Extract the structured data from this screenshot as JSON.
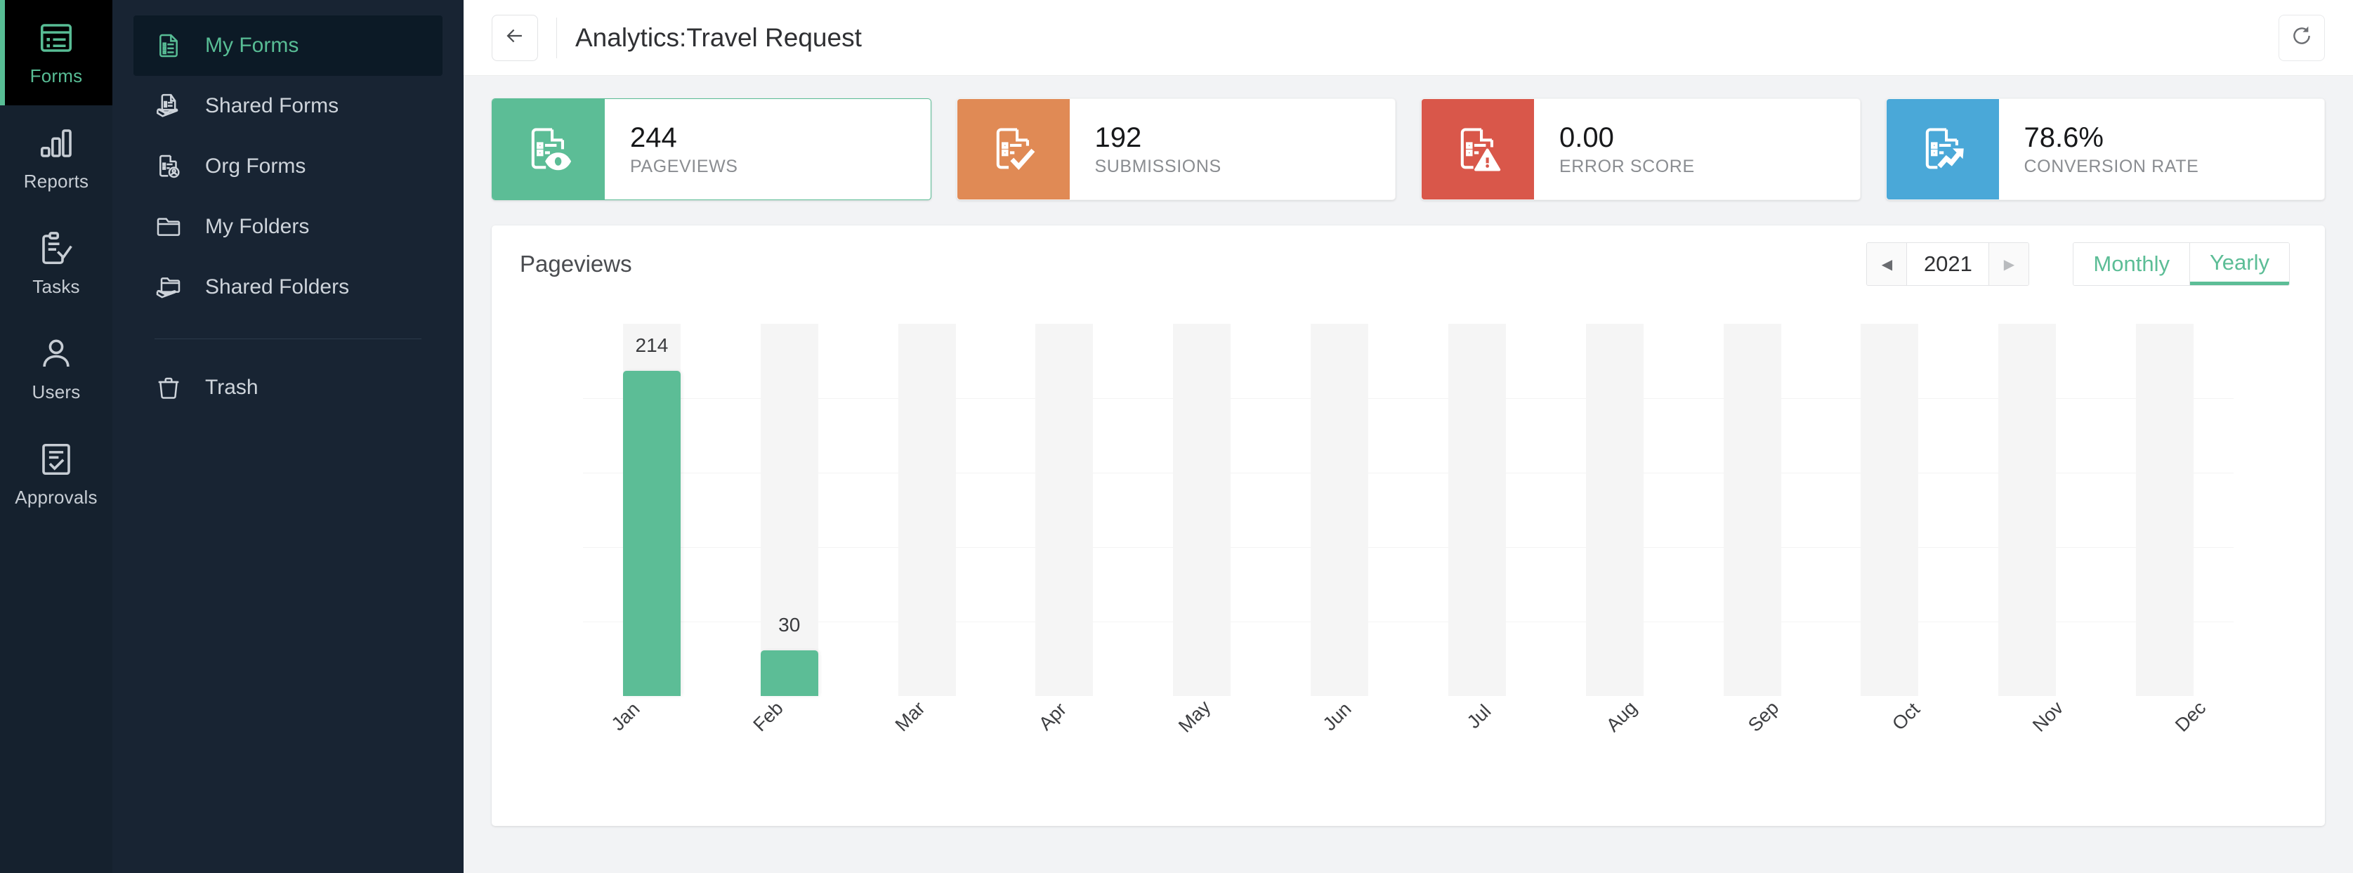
{
  "rail": {
    "items": [
      {
        "label": "Forms",
        "icon": "forms-icon",
        "active": true
      },
      {
        "label": "Reports",
        "icon": "reports-icon",
        "active": false
      },
      {
        "label": "Tasks",
        "icon": "tasks-icon",
        "active": false
      },
      {
        "label": "Users",
        "icon": "users-icon",
        "active": false
      },
      {
        "label": "Approvals",
        "icon": "approvals-icon",
        "active": false
      }
    ]
  },
  "subnav": {
    "items": [
      {
        "label": "My Forms",
        "icon": "document-list-icon",
        "active": true
      },
      {
        "label": "Shared Forms",
        "icon": "document-shared-icon",
        "active": false
      },
      {
        "label": "Org Forms",
        "icon": "document-user-icon",
        "active": false
      },
      {
        "label": "My Folders",
        "icon": "folder-icon",
        "active": false
      },
      {
        "label": "Shared Folders",
        "icon": "folder-shared-icon",
        "active": false
      }
    ],
    "trash": {
      "label": "Trash",
      "icon": "trash-icon"
    }
  },
  "topbar": {
    "back_icon": "arrow-left-icon",
    "title": "Analytics:Travel Request",
    "refresh_icon": "refresh-icon"
  },
  "cards": [
    {
      "value": "244",
      "label": "PAGEVIEWS",
      "icon": "document-eye-icon",
      "color": "#5cbd96",
      "accent": "accent-green"
    },
    {
      "value": "192",
      "label": "SUBMISSIONS",
      "icon": "document-check-icon",
      "color": "#e08a55",
      "accent": "accent-orange"
    },
    {
      "value": "0.00",
      "label": "ERROR SCORE",
      "icon": "document-alert-icon",
      "color": "#d9574a",
      "accent": "accent-red"
    },
    {
      "value": "78.6%",
      "label": "CONVERSION RATE",
      "icon": "document-trend-icon",
      "color": "#4aa8d8",
      "accent": "accent-blue"
    }
  ],
  "panel": {
    "title": "Pageviews",
    "year": "2021",
    "prev_icon": "caret-left-icon",
    "next_icon": "caret-right-icon",
    "range_options": [
      {
        "label": "Monthly",
        "active": false
      },
      {
        "label": "Yearly",
        "active": true
      }
    ]
  },
  "chart_data": {
    "type": "bar",
    "title": "Pageviews",
    "xlabel": "",
    "ylabel": "",
    "categories": [
      "Jan",
      "Feb",
      "Mar",
      "Apr",
      "May",
      "Jun",
      "Jul",
      "Aug",
      "Sep",
      "Oct",
      "Nov",
      "Dec"
    ],
    "values": [
      214,
      30,
      0,
      0,
      0,
      0,
      0,
      0,
      0,
      0,
      0,
      0
    ],
    "value_labels": [
      "214",
      "30",
      "",
      "",
      "",
      "",
      "",
      "",
      "",
      "",
      "",
      ""
    ],
    "ylim": [
      0,
      245
    ],
    "grid": true,
    "legend": "none",
    "bar_color": "#5cbd96",
    "track_color": "#f5f5f5"
  }
}
